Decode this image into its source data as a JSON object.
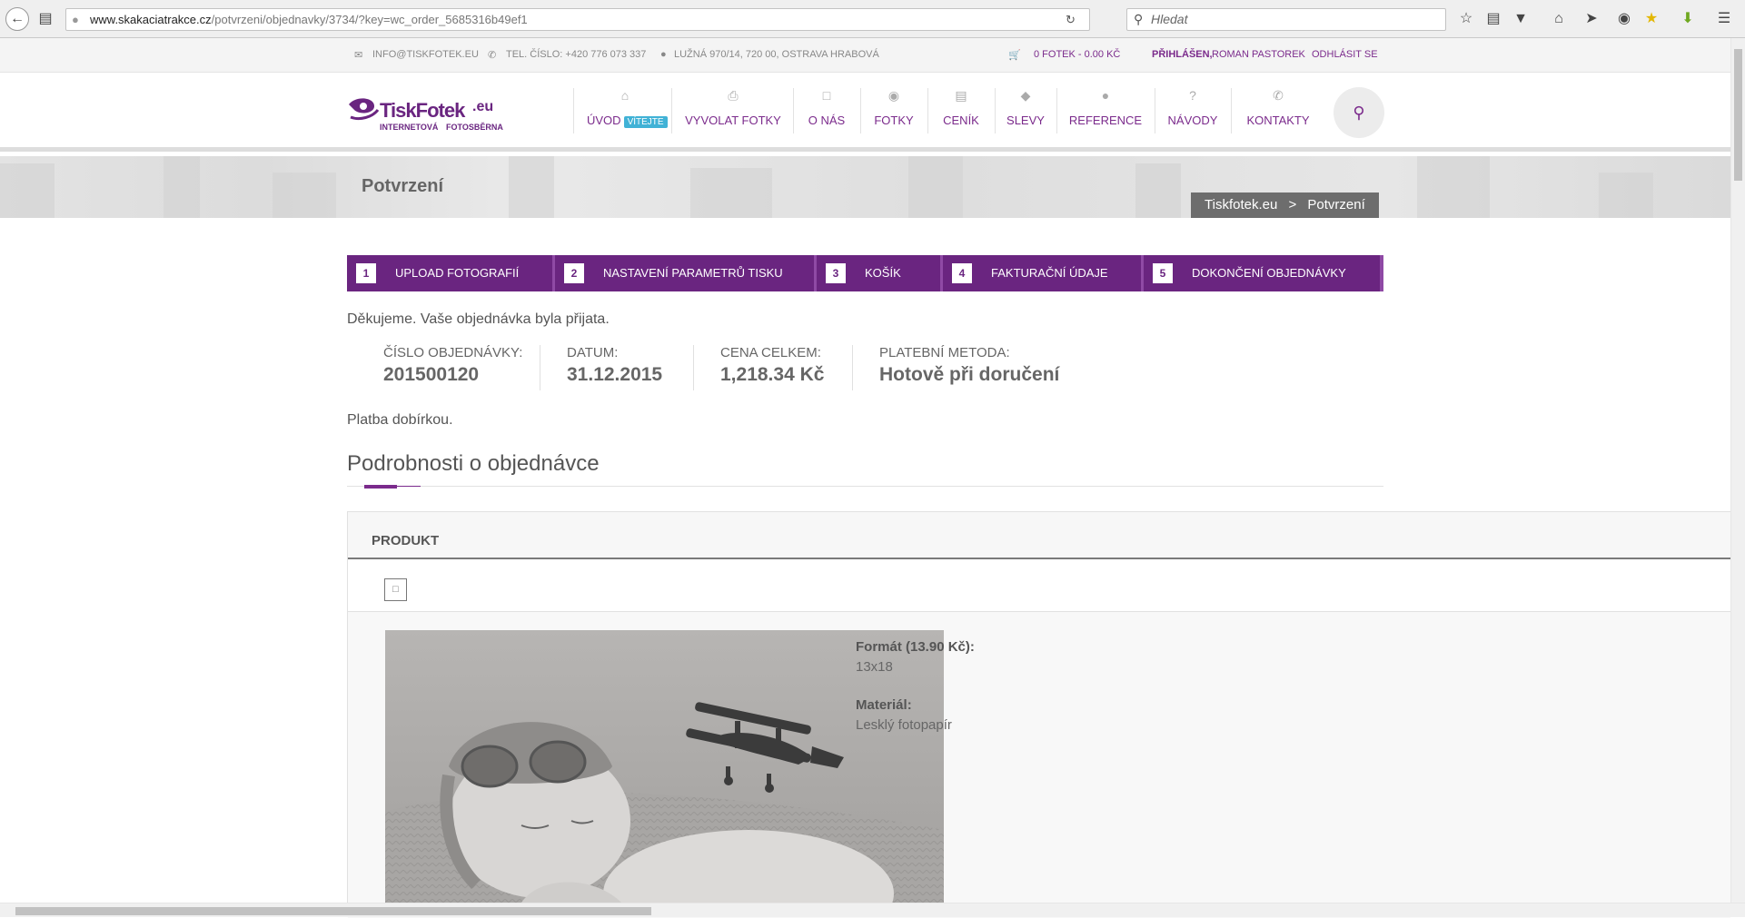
{
  "browser": {
    "url_host": "www.skakaciatrakce.cz",
    "url_path": "/potvrzeni/objednavky/3734/?key=wc_order_5685316b49ef1",
    "search_placeholder": "Hledat"
  },
  "topbar": {
    "email": "INFO@TISKFOTEK.EU",
    "phone": "TEL. ČÍSLO: +420 776 073 337",
    "address": "LUŽNÁ 970/14, 720 00, OSTRAVA HRABOVÁ",
    "cart": "0 FOTEK - 0.00 KČ",
    "logged_label": "PŘIHLÁŠEN,",
    "user_name": "ROMAN PASTOREK",
    "logout": "ODHLÁSIT SE"
  },
  "logo": {
    "brand": "TiskFotek",
    "tld": ".eu",
    "tagline_1": "INTERNETOVÁ",
    "tagline_2": "FOTOSBĚRNA"
  },
  "nav": {
    "items": [
      {
        "label": "ÚVOD",
        "icon": "home-icon"
      },
      {
        "label": "VYVOLAT FOTKY",
        "icon": "printer-icon"
      },
      {
        "label": "O NÁS",
        "icon": "document-icon"
      },
      {
        "label": "FOTKY",
        "icon": "camera-icon"
      },
      {
        "label": "CENÍK",
        "icon": "price-list-icon"
      },
      {
        "label": "SLEVY",
        "icon": "tag-icon"
      },
      {
        "label": "REFERENCE",
        "icon": "comment-icon"
      },
      {
        "label": "NÁVODY",
        "icon": "question-icon"
      },
      {
        "label": "KONTAKTY",
        "icon": "phone-icon"
      }
    ],
    "badge": "VÍTEJTE"
  },
  "page": {
    "title": "Potvrzení",
    "breadcrumb_home": "Tiskfotek.eu",
    "breadcrumb_sep": ">",
    "breadcrumb_current": "Potvrzení"
  },
  "steps": [
    {
      "num": "1",
      "label": "UPLOAD FOTOGRAFIÍ"
    },
    {
      "num": "2",
      "label": "NASTAVENÍ PARAMETRŮ TISKU"
    },
    {
      "num": "3",
      "label": "KOŠÍK"
    },
    {
      "num": "4",
      "label": "FAKTURAČNÍ ÚDAJE"
    },
    {
      "num": "5",
      "label": "DOKONČENÍ OBJEDNÁVKY"
    }
  ],
  "order": {
    "thanks": "Děkujeme. Vaše objednávka byla přijata.",
    "number_label": "ČÍSLO OBJEDNÁVKY:",
    "number": "201500120",
    "date_label": "DATUM:",
    "date": "31.12.2015",
    "total_label": "CENA CELKEM:",
    "total": "1,218.34 Kč",
    "payment_label": "PLATEBNÍ METODA:",
    "payment": "Hotově při doručení",
    "payment_note": "Platba dobírkou."
  },
  "details": {
    "heading": "Podrobnosti o objednávce",
    "product_header": "PRODUKT",
    "format_label": "Formát (13.90 Kč):",
    "format_value": "13x18",
    "material_label": "Materiál:",
    "material_value": "Lesklý fotopapír"
  },
  "colors": {
    "brand_purple": "#6a2580",
    "badge_blue": "#41b2d6"
  }
}
